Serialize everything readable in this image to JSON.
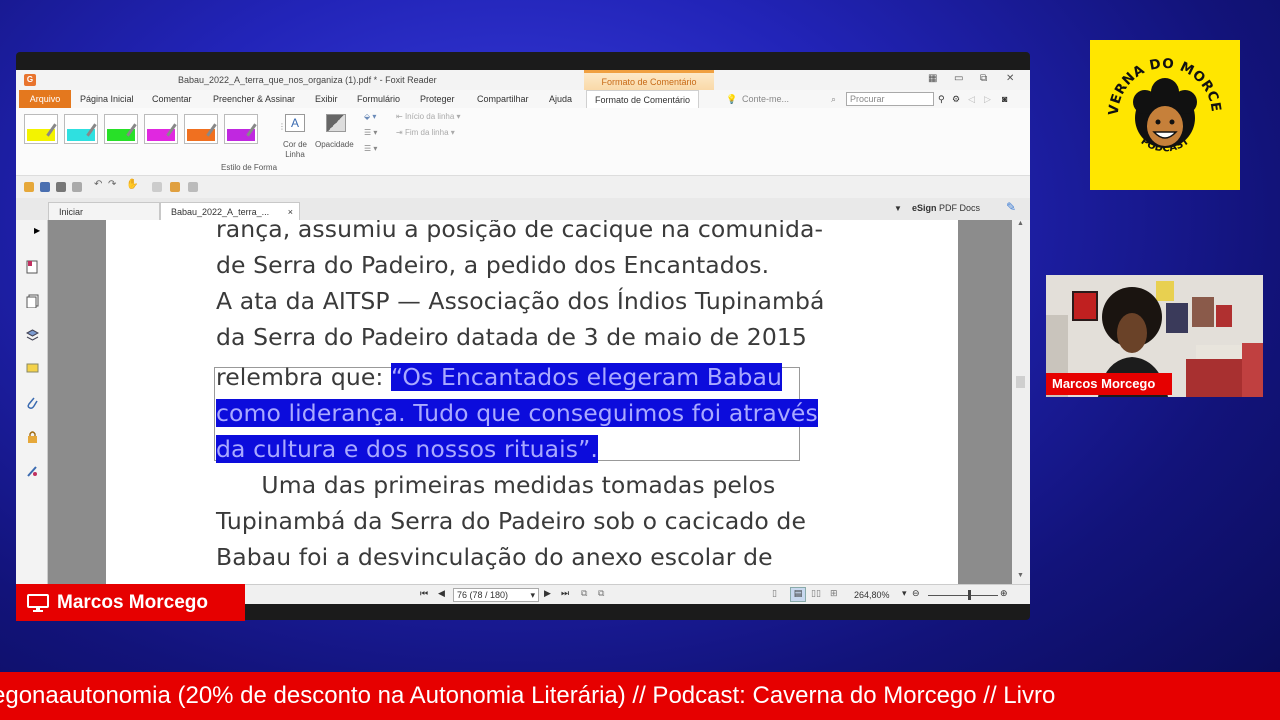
{
  "app": {
    "window_title": "Babau_2022_A_terra_que_nos_organiza (1).pdf * - Foxit Reader",
    "context_tab_title": "Formato de Comentário",
    "menu": {
      "arquivo": "Arquivo",
      "items": [
        "Página Inicial",
        "Comentar",
        "Preencher & Assinar",
        "Exibir",
        "Formulário",
        "Proteger",
        "Compartilhar",
        "Ajuda"
      ],
      "active": "Formato de Comentário",
      "tell_me": "Conte-me...",
      "search_placeholder": "Procurar"
    },
    "ribbon": {
      "swatch_colors": [
        "#f3f300",
        "#2fe0e0",
        "#28e028",
        "#e028e0",
        "#f07020",
        "#c028e0"
      ],
      "group_label": "Estilo de Forma",
      "line_color": "Cor de Linha",
      "opacity": "Opacidade",
      "line_start": "Início da linha",
      "line_end": "Fim da linha"
    },
    "tabs": {
      "home": "Iniciar",
      "doc": "Babau_2022_A_terra_...",
      "close": "×"
    },
    "esign": "eSign PDF Docs",
    "document": {
      "lines": [
        "rança, assumiu a posição de cacique na comunida-",
        "de Serra do Padeiro, a pedido dos Encantados.",
        "A ata da AITSP — Associação dos Índios Tupinambá",
        "da Serra do Padeiro datada de 3 de maio de 2015"
      ],
      "line5_plain": "relembra que: ",
      "line5_hl": "“Os Encantados elegeram Babau",
      "line6_hl": "como liderança. Tudo que conseguimos foi através",
      "line7_hl": "da cultura e dos nossos rituais”.",
      "lines_after": [
        "      Uma das primeiras medidas tomadas pelos",
        "Tupinambá da Serra do Padeiro sob o cacicado de",
        "Babau foi a desvinculação do anexo escolar de"
      ]
    },
    "status": {
      "page_field": "76 (78 / 180)",
      "zoom": "264,80%"
    }
  },
  "overlay": {
    "presenter_name": "Marcos Morcego",
    "cam_name": "Marcos Morcego",
    "logo_top": "CAVERNA DO MORCEGO",
    "logo_bottom": "PODCAST",
    "ticker": "egonaautonomia (20% de desconto na Autonomia Literária) // Podcast: Caverna do Morcego // Livro"
  },
  "colors": {
    "accent_red": "#e60000",
    "highlight": "#0c0cdc",
    "foxit_orange": "#e4781e",
    "logo_yellow": "#ffe600"
  }
}
